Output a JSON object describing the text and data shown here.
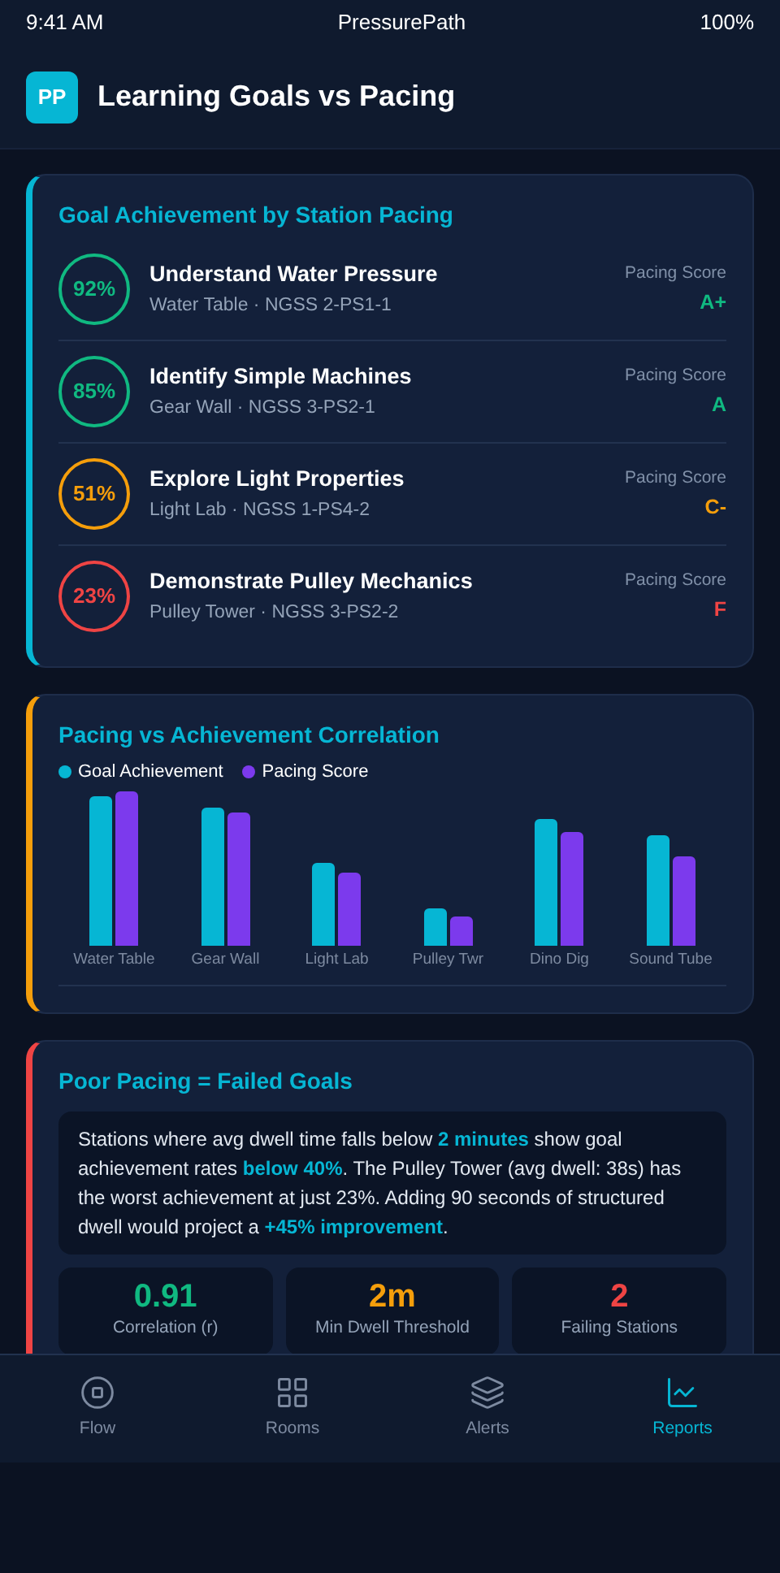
{
  "status_bar": {
    "time": "9:41 AM",
    "app": "PressurePath",
    "battery": "100%"
  },
  "header": {
    "logo": "PP",
    "title": "Learning Goals vs Pacing"
  },
  "goals_card": {
    "title": "Goal Achievement by Station Pacing",
    "goals": [
      {
        "percent": "92%",
        "color": "#10b981",
        "title": "Understand Water Pressure",
        "subtitle": "Water Table · NGSS 2-PS1-1",
        "score_label": "Pacing Score",
        "grade": "A+"
      },
      {
        "percent": "85%",
        "color": "#10b981",
        "title": "Identify Simple Machines",
        "subtitle": "Gear Wall · NGSS 3-PS2-1",
        "score_label": "Pacing Score",
        "grade": "A"
      },
      {
        "percent": "51%",
        "color": "#f59e0b",
        "title": "Explore Light Properties",
        "subtitle": "Light Lab · NGSS 1-PS4-2",
        "score_label": "Pacing Score",
        "grade": "C-"
      },
      {
        "percent": "23%",
        "color": "#ef4444",
        "title": "Demonstrate Pulley Mechanics",
        "subtitle": "Pulley Tower · NGSS 3-PS2-2",
        "score_label": "Pacing Score",
        "grade": "F"
      }
    ]
  },
  "chart_card": {
    "title": "Pacing vs Achievement Correlation",
    "legend": [
      {
        "label": "Goal Achievement",
        "color": "#06b6d4"
      },
      {
        "label": "Pacing Score",
        "color": "#7c3aed"
      }
    ],
    "categories": [
      "Water Table",
      "Gear Wall",
      "Light Lab",
      "Pulley Twr",
      "Dino Dig",
      "Sound Tube"
    ]
  },
  "insight_card": {
    "title": "Poor Pacing = Failed Goals",
    "text": [
      {
        "text": "Stations where avg dwell time falls below ",
        "highlight": false
      },
      {
        "text": "2 minutes",
        "highlight": true
      },
      {
        "text": " show goal achievement rates ",
        "highlight": false
      },
      {
        "text": "below 40%",
        "highlight": true
      },
      {
        "text": ". The Pulley Tower (avg dwell: 38s) has the worst achievement at just 23%. Adding 90 seconds of structured dwell would project a ",
        "highlight": false
      },
      {
        "text": "+45% improvement",
        "highlight": true
      },
      {
        "text": ".",
        "highlight": false
      }
    ],
    "stats": [
      {
        "value": "0.91",
        "label": "Correlation (r)",
        "color": "#10b981"
      },
      {
        "value": "2m",
        "label": "Min Dwell Threshold",
        "color": "#f59e0b"
      },
      {
        "value": "2",
        "label": "Failing Stations",
        "color": "#ef4444"
      }
    ]
  },
  "nav": [
    {
      "kind": "flow",
      "label": "Flow",
      "selected": false
    },
    {
      "kind": "rooms",
      "label": "Rooms",
      "selected": false
    },
    {
      "kind": "alerts",
      "label": "Alerts",
      "selected": false
    },
    {
      "kind": "reports",
      "label": "Reports",
      "selected": true
    }
  ]
}
